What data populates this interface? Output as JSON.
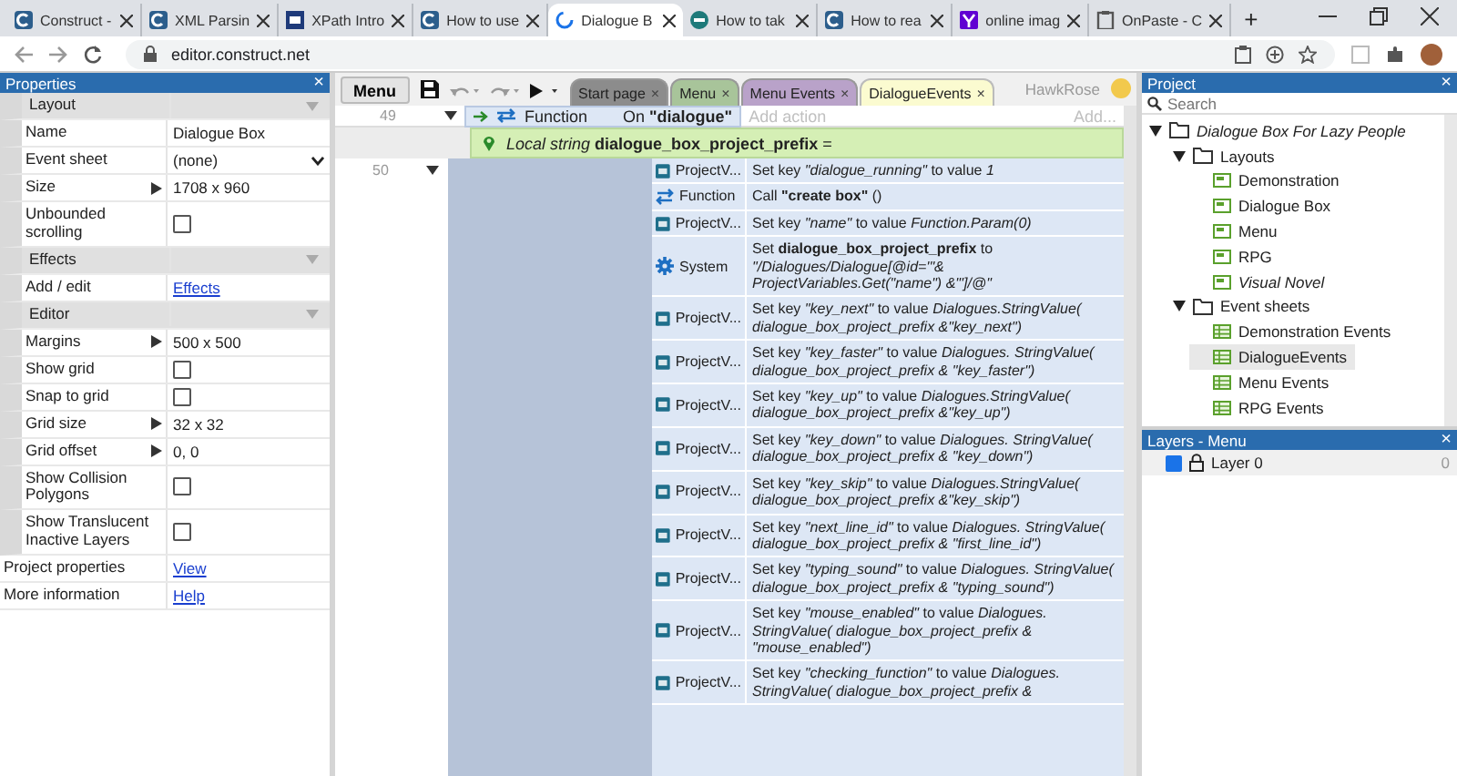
{
  "browser": {
    "tabs": [
      {
        "title": "Construct -",
        "selected": false
      },
      {
        "title": "XML Parsin",
        "selected": false
      },
      {
        "title": "XPath Intro",
        "selected": false
      },
      {
        "title": "How to use",
        "selected": false
      },
      {
        "title": "Dialogue B",
        "selected": true
      },
      {
        "title": "How to tak",
        "selected": false
      },
      {
        "title": "How to rea",
        "selected": false
      },
      {
        "title": "online imag",
        "selected": false
      },
      {
        "title": "OnPaste - C",
        "selected": false
      }
    ],
    "new_tab": "+",
    "address": "editor.construct.net"
  },
  "properties": {
    "title": "Properties",
    "close": "×",
    "rows": [
      {
        "kind": "section",
        "label": "Layout"
      },
      {
        "kind": "text",
        "label": "Name",
        "value": "Dialogue Box"
      },
      {
        "kind": "select",
        "label": "Event sheet",
        "value": "(none)"
      },
      {
        "kind": "expand",
        "label": "Size",
        "value": "1708 x 960"
      },
      {
        "kind": "checkbox",
        "label": "Unbounded scrolling",
        "checked": false
      },
      {
        "kind": "section",
        "label": "Effects"
      },
      {
        "kind": "link",
        "label": "Add / edit",
        "value": "Effects"
      },
      {
        "kind": "section",
        "label": "Editor"
      },
      {
        "kind": "expand",
        "label": "Margins",
        "value": "500 x 500"
      },
      {
        "kind": "checkbox",
        "label": "Show grid",
        "checked": false
      },
      {
        "kind": "checkbox",
        "label": "Snap to grid",
        "checked": false
      },
      {
        "kind": "expand",
        "label": "Grid size",
        "value": "32 x 32"
      },
      {
        "kind": "expand",
        "label": "Grid offset",
        "value": "0, 0"
      },
      {
        "kind": "checkbox",
        "label": "Show Collision Polygons",
        "checked": false
      },
      {
        "kind": "checkbox",
        "label": "Show Translucent Inactive Layers",
        "checked": false
      },
      {
        "kind": "toplink",
        "label": "Project properties",
        "value": "View"
      },
      {
        "kind": "toplink",
        "label": "More information",
        "value": "Help"
      }
    ]
  },
  "toolbar": {
    "menu_button": "Menu",
    "user": "HawkRose"
  },
  "editor_tabs": [
    {
      "label": "Start page",
      "close": "×",
      "color": "#8c8c8c",
      "selected": false
    },
    {
      "label": "Menu",
      "close": "×",
      "color": "#a8c49a",
      "selected": false
    },
    {
      "label": "Menu Events",
      "close": "×",
      "color": "#b9a2c9",
      "selected": false
    },
    {
      "label": "DialogueEvents",
      "close": "×",
      "color": "#fbfbd0",
      "selected": true
    }
  ],
  "events": {
    "line_1": "49",
    "condition_object": "Function",
    "condition": "On **\"dialogue\"**",
    "add_action": "Add action",
    "add_more": "Add...",
    "local_variable": "*Local string* **dialogue_box_project_prefix** =",
    "line_2": "50",
    "actions": [
      {
        "kind": "project",
        "object": "ProjectV...",
        "text": "Set key *\"dialogue_running\"* to value *1*"
      },
      {
        "kind": "function",
        "object": "Function",
        "text": "Call **\"create box\"** ()"
      },
      {
        "kind": "project",
        "object": "ProjectV...",
        "text": "Set key *\"name\"* to value *Function.Param(0)*"
      },
      {
        "kind": "system",
        "object": "System",
        "text": "Set **dialogue_box_project_prefix** to *\"/Dialogues/Dialogue[@id='\"& ProjectVariables.Get(\"name\") &\"']/@\"*"
      },
      {
        "kind": "project",
        "object": "ProjectV...",
        "text": "Set key *\"key_next\"* to value *Dialogues.StringValue( dialogue_box_project_prefix &\"key_next\")*"
      },
      {
        "kind": "project",
        "object": "ProjectV...",
        "text": "Set key *\"key_faster\"* to value *Dialogues. StringValue( dialogue_box_project_prefix & \"key_faster\")*"
      },
      {
        "kind": "project",
        "object": "ProjectV...",
        "text": "Set key *\"key_up\"* to value *Dialogues.StringValue( dialogue_box_project_prefix &\"key_up\")*"
      },
      {
        "kind": "project",
        "object": "ProjectV...",
        "text": "Set key *\"key_down\"* to value *Dialogues. StringValue( dialogue_box_project_prefix & \"key_down\")*"
      },
      {
        "kind": "project",
        "object": "ProjectV...",
        "text": "Set key *\"key_skip\"* to value *Dialogues.StringValue( dialogue_box_project_prefix &\"key_skip\")*"
      },
      {
        "kind": "project",
        "object": "ProjectV...",
        "text": "Set key *\"next_line_id\"* to value *Dialogues. StringValue( dialogue_box_project_prefix & \"first_line_id\")*"
      },
      {
        "kind": "project",
        "object": "ProjectV...",
        "text": "Set key *\"typing_sound\"* to value *Dialogues. StringValue( dialogue_box_project_prefix & \"typing_sound\")*"
      },
      {
        "kind": "project",
        "object": "ProjectV...",
        "text": "Set key *\"mouse_enabled\"* to value *Dialogues. StringValue( dialogue_box_project_prefix & \"mouse_enabled\")*"
      },
      {
        "kind": "project",
        "object": "ProjectV...",
        "text": "Set key *\"checking_function\"* to value *Dialogues. StringValue( dialogue_box_project_prefix &*"
      }
    ]
  },
  "project": {
    "title": "Project",
    "close": "×",
    "search": {
      "placeholder": "Search"
    },
    "tree": [
      {
        "label": "Dialogue Box For Lazy People",
        "kind": "folder",
        "italic": true,
        "expanded": true,
        "selected": false,
        "children": [
          {
            "label": "Layouts",
            "kind": "folder",
            "italic": false,
            "expanded": true,
            "selected": false,
            "children": [
              {
                "label": "Demonstration",
                "kind": "layout",
                "italic": false,
                "selected": false
              },
              {
                "label": "Dialogue Box",
                "kind": "layout",
                "italic": false,
                "selected": false
              },
              {
                "label": "Menu",
                "kind": "layout",
                "italic": false,
                "selected": false
              },
              {
                "label": "RPG",
                "kind": "layout",
                "italic": false,
                "selected": false
              },
              {
                "label": "Visual Novel",
                "kind": "layout",
                "italic": true,
                "selected": false
              }
            ]
          },
          {
            "label": "Event sheets",
            "kind": "folder",
            "italic": false,
            "expanded": true,
            "selected": false,
            "children": [
              {
                "label": "Demonstration Events",
                "kind": "sheet",
                "italic": false,
                "selected": false
              },
              {
                "label": "DialogueEvents",
                "kind": "sheet",
                "italic": false,
                "selected": true
              },
              {
                "label": "Menu Events",
                "kind": "sheet",
                "italic": false,
                "selected": false
              },
              {
                "label": "RPG Events",
                "kind": "sheet",
                "italic": false,
                "selected": false
              }
            ]
          }
        ]
      }
    ]
  },
  "layers": {
    "title": "Layers - Menu",
    "close": "×",
    "items": [
      {
        "label": "Layer 0",
        "checked": true,
        "value": "0"
      }
    ]
  }
}
